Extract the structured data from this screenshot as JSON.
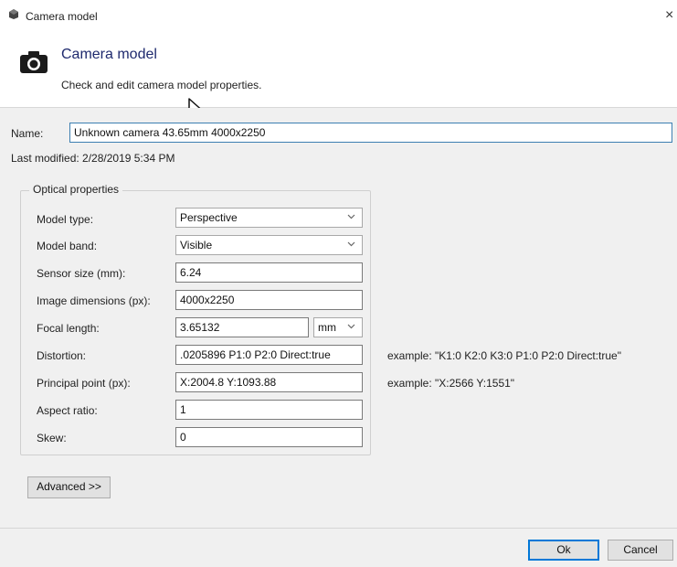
{
  "window": {
    "title": "Camera model",
    "close_glyph": "×",
    "icon": "camera-app-icon"
  },
  "header": {
    "title": "Camera model",
    "subtitle": "Check and edit camera model properties.",
    "icon": "camera-icon"
  },
  "name_field": {
    "label": "Name:",
    "value": "Unknown camera 43.65mm 4000x2250"
  },
  "last_modified": {
    "label": "Last modified: 2/28/2019 5:34 PM"
  },
  "optical": {
    "group_title": "Optical properties",
    "model_type": {
      "label": "Model type:",
      "value": "Perspective"
    },
    "model_band": {
      "label": "Model band:",
      "value": "Visible"
    },
    "sensor_size": {
      "label": "Sensor size (mm):",
      "value": "6.24"
    },
    "image_dimensions": {
      "label": "Image dimensions (px):",
      "value": "4000x2250"
    },
    "focal_length": {
      "label": "Focal length:",
      "value": "3.65132",
      "unit": "mm"
    },
    "distortion": {
      "label": "Distortion:",
      "value": ".0205896 P1:0 P2:0 Direct:true",
      "example": "example: \"K1:0 K2:0 K3:0 P1:0 P2:0 Direct:true\""
    },
    "principal_point": {
      "label": "Principal point (px):",
      "value": "X:2004.8 Y:1093.88",
      "example": "example: \"X:2566 Y:1551\""
    },
    "aspect_ratio": {
      "label": "Aspect ratio:",
      "value": "1"
    },
    "skew": {
      "label": "Skew:",
      "value": "0"
    }
  },
  "buttons": {
    "advanced": "Advanced >>",
    "ok": "Ok",
    "cancel": "Cancel"
  },
  "colors": {
    "accent": "#0078d7",
    "header_title": "#1f2a6e",
    "panel_bg": "#f0f0f0"
  }
}
